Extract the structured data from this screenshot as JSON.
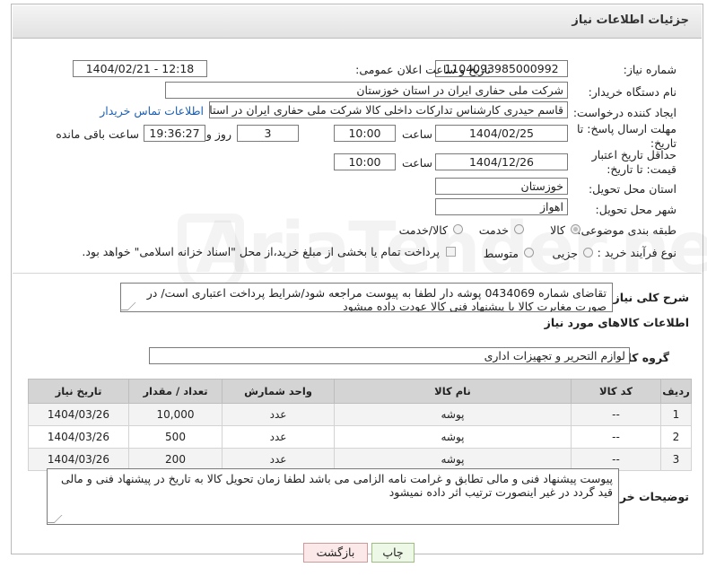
{
  "header": {
    "title": "جزئیات اطلاعات نیاز"
  },
  "fields": {
    "need_number_label": "شماره نیاز:",
    "need_number": "1104093985000992",
    "announce_label": "تاریخ و ساعت اعلان عمومی:",
    "announce_value": "1404/02/21 - 12:18",
    "buyer_org_label": "نام دستگاه خریدار:",
    "buyer_org": "شرکت ملی حفاری ایران در استان خوزستان",
    "creator_label": "ایجاد کننده درخواست:",
    "creator": "قاسم حیدری کارشناس تدارکات داخلی کالا شرکت ملی حفاری ایران در استان خوزستان",
    "buyer_contact_link": "اطلاعات تماس خریدار",
    "deadline_label": "مهلت ارسال پاسخ: تا تاریخ:",
    "deadline_date": "1404/02/25",
    "time_label": "ساعت",
    "deadline_time": "10:00",
    "days_value": "3",
    "days_label": "روز و",
    "remaining_time": "19:36:27",
    "remaining_label": "ساعت باقی مانده",
    "price_deadline_label": "حداقل تاریخ اعتبار قیمت: تا تاریخ:",
    "price_deadline_date": "1404/12/26",
    "price_deadline_time": "10:00",
    "province_label": "استان محل تحویل:",
    "province": "خوزستان",
    "city_label": "شهر محل تحویل:",
    "city": "اهواز",
    "category_label": "طبقه بندی موضوعی:",
    "category_options": [
      "کالا",
      "خدمت",
      "کالا/خدمت"
    ],
    "category_selected": "کالا",
    "process_label": "نوع فرآیند خرید :",
    "process_options": [
      "جزیی",
      "متوسط"
    ],
    "payment_note": "پرداخت تمام یا بخشی از مبلغ خرید،از محل \"اسناد خزانه اسلامی\" خواهد بود."
  },
  "description": {
    "label": "شرح کلی نیاز:",
    "text": "تقاضای شماره 0434069 پوشه دار  لطفا به پیوست مراجعه شود/شرایط پرداخت اعتباری است/ در صورت مغایرت کالا با پیشنهاد فنی کالا عودت داده میشود"
  },
  "goods_section": {
    "title": "اطلاعات کالاهای مورد نیاز",
    "group_label": "گروه کالا:",
    "group_value": "لوازم التحریر و تجهیزات اداری"
  },
  "table": {
    "headers": [
      "ردیف",
      "کد کالا",
      "نام کالا",
      "واحد شمارش",
      "تعداد / مقدار",
      "تاریخ نیاز"
    ],
    "rows": [
      [
        "1",
        "--",
        "پوشه",
        "عدد",
        "10,000",
        "1404/03/26"
      ],
      [
        "2",
        "--",
        "پوشه",
        "عدد",
        "500",
        "1404/03/26"
      ],
      [
        "3",
        "--",
        "پوشه",
        "عدد",
        "200",
        "1404/03/26"
      ]
    ]
  },
  "buyer_notes": {
    "label": "توضیحات خریدار:",
    "text": "پیوست پیشنهاد فنی و مالی تطابق و غرامت نامه الزامی می باشد لطفا زمان تحویل کالا به تاریخ در پیشنهاد فنی و مالی قید گردد در غیر اینصورت ترتیب اثر داده نمیشود"
  },
  "buttons": {
    "print": "چاپ",
    "back": "بازگشت"
  },
  "watermark": "AriaTender.neT"
}
